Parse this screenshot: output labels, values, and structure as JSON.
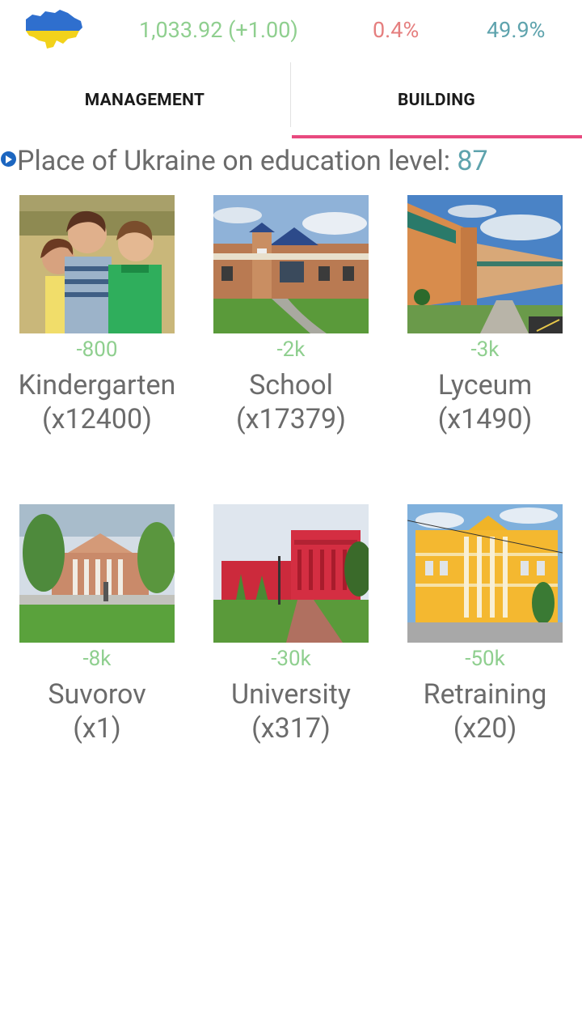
{
  "topbar": {
    "money": "1,033.92 (+1.00)",
    "inflation": "0.4%",
    "approval": "49.9%",
    "flag_icon": "ukraine-map-flag-icon",
    "colors": {
      "money": "#8fcf8f",
      "inflation": "#e57f7f",
      "approval": "#5ea3ad"
    }
  },
  "tabs": [
    {
      "label": "MANAGEMENT",
      "active": false
    },
    {
      "label": "BUILDING",
      "active": true
    }
  ],
  "accent": "#e84a7f",
  "place": {
    "label": "Place of Ukraine on education level: ",
    "value": "87",
    "icon": "play-info-icon"
  },
  "buildings": [
    {
      "cost": "-800",
      "name": "Kindergarten",
      "count": "(x12400)",
      "image": "children-photo"
    },
    {
      "cost": "-2k",
      "name": "School",
      "count": "(x17379)",
      "image": "school-building-photo"
    },
    {
      "cost": "-3k",
      "name": "Lyceum",
      "count": "(x1490)",
      "image": "lyceum-building-photo"
    },
    {
      "cost": "-8k",
      "name": "Suvorov",
      "count": "(x1)",
      "image": "suvorov-academy-photo"
    },
    {
      "cost": "-30k",
      "name": "University",
      "count": "(x317)",
      "image": "red-university-photo"
    },
    {
      "cost": "-50k",
      "name": "Retraining",
      "count": "(x20)",
      "image": "yellow-institute-photo"
    }
  ]
}
